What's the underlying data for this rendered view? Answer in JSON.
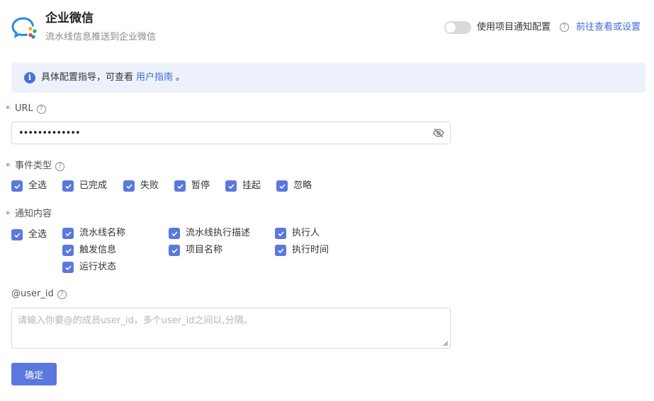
{
  "header": {
    "title": "企业微信",
    "subtitle": "流水线信息推送到企业微信",
    "logo_icon": "wecom-logo-icon",
    "use_project_config_label": "使用项目通知配置",
    "use_project_config_enabled": false,
    "goto_link": "前往查看或设置"
  },
  "banner": {
    "text_before": "具体配置指导，可查看",
    "link": "用户指南",
    "text_after": "。"
  },
  "form": {
    "url": {
      "label": "URL",
      "required": "*",
      "value": "•••••••••••••"
    },
    "event_type": {
      "label": "事件类型",
      "required": "*",
      "options": [
        "全选",
        "已完成",
        "失败",
        "暂停",
        "挂起",
        "忽略"
      ],
      "checked": [
        true,
        true,
        true,
        true,
        true,
        true
      ]
    },
    "notify_content": {
      "label": "通知内容",
      "required": "*",
      "select_all": "全选",
      "options": [
        "流水线名称",
        "流水线执行描述",
        "执行人",
        "触发信息",
        "项目名称",
        "执行时间",
        "运行状态"
      ],
      "checked": [
        true,
        true,
        true,
        true,
        true,
        true,
        true
      ]
    },
    "user_id": {
      "label": "@user_id",
      "placeholder": "请输入你要@的成员user_id，多个user_id之间以,分隔。"
    },
    "submit_label": "确定"
  },
  "colors": {
    "accent": "#5b78df",
    "link": "#3f6ed6",
    "banner_bg": "#edf1fb",
    "required": "#e54545"
  }
}
